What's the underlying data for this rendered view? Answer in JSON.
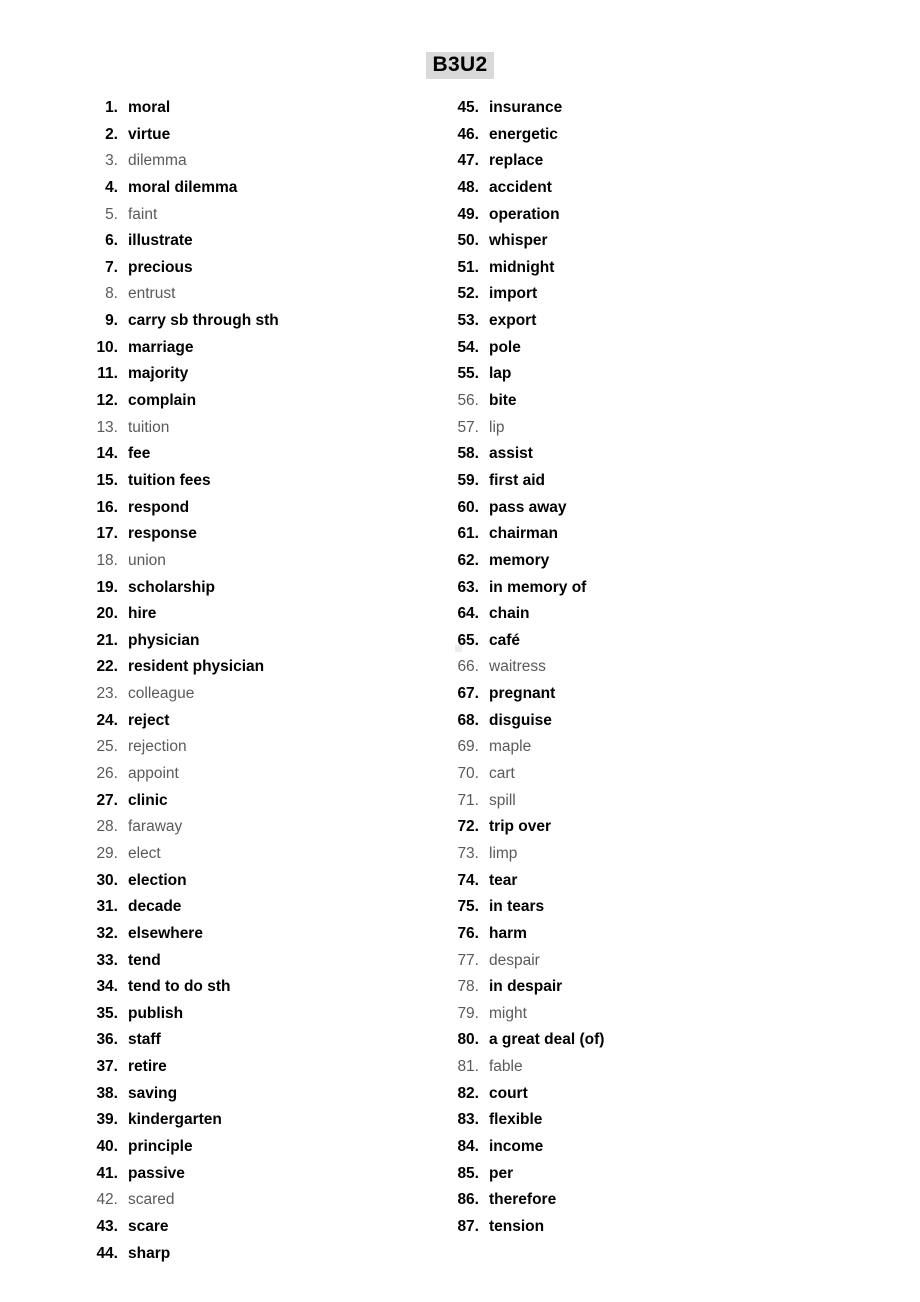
{
  "document": {
    "title": "B3U2",
    "title_highlight_color": "#d9d9d9",
    "bold_color": "#000000",
    "plain_color": "#5a5a5a"
  },
  "columns": {
    "left": {
      "items": [
        {
          "num": "1.",
          "word": "moral",
          "num_style": "bold",
          "word_style": "bold"
        },
        {
          "num": "2.",
          "word": "virtue",
          "num_style": "bold",
          "word_style": "bold"
        },
        {
          "num": "3.",
          "word": "dilemma",
          "num_style": "plain",
          "word_style": "plain"
        },
        {
          "num": "4.",
          "word": "moral dilemma",
          "num_style": "bold",
          "word_style": "bold"
        },
        {
          "num": "5.",
          "word": "faint",
          "num_style": "plain",
          "word_style": "plain"
        },
        {
          "num": "6.",
          "word": "illustrate",
          "num_style": "bold",
          "word_style": "bold"
        },
        {
          "num": "7.",
          "word": "precious",
          "num_style": "bold",
          "word_style": "bold"
        },
        {
          "num": "8.",
          "word": "entrust",
          "num_style": "plain",
          "word_style": "plain"
        },
        {
          "num": "9.",
          "word": "carry sb through sth",
          "num_style": "bold",
          "word_style": "bold"
        },
        {
          "num": "10.",
          "word": "marriage",
          "num_style": "bold",
          "word_style": "bold"
        },
        {
          "num": "11.",
          "word": "majority",
          "num_style": "bold",
          "word_style": "bold"
        },
        {
          "num": "12.",
          "word": "complain",
          "num_style": "bold",
          "word_style": "bold"
        },
        {
          "num": "13.",
          "word": "tuition",
          "num_style": "plain",
          "word_style": "plain"
        },
        {
          "num": "14.",
          "word": "fee",
          "num_style": "bold",
          "word_style": "bold"
        },
        {
          "num": "15.",
          "word": "tuition fees",
          "num_style": "bold",
          "word_style": "bold"
        },
        {
          "num": "16.",
          "word": "respond",
          "num_style": "bold",
          "word_style": "bold"
        },
        {
          "num": "17.",
          "word": "response",
          "num_style": "bold",
          "word_style": "bold"
        },
        {
          "num": "18.",
          "word": "union",
          "num_style": "plain",
          "word_style": "plain"
        },
        {
          "num": "19.",
          "word": "scholarship",
          "num_style": "bold",
          "word_style": "bold"
        },
        {
          "num": "20.",
          "word": "hire",
          "num_style": "bold",
          "word_style": "bold"
        },
        {
          "num": "21.",
          "word": "physician",
          "num_style": "bold",
          "word_style": "bold"
        },
        {
          "num": "22.",
          "word": "resident physician",
          "num_style": "bold",
          "word_style": "bold"
        },
        {
          "num": "23.",
          "word": "colleague",
          "num_style": "plain",
          "word_style": "plain"
        },
        {
          "num": "24.",
          "word": "reject",
          "num_style": "bold",
          "word_style": "bold"
        },
        {
          "num": "25.",
          "word": "rejection",
          "num_style": "plain",
          "word_style": "plain"
        },
        {
          "num": "26.",
          "word": "appoint",
          "num_style": "plain",
          "word_style": "plain"
        },
        {
          "num": "27.",
          "word": "clinic",
          "num_style": "bold",
          "word_style": "bold"
        },
        {
          "num": "28.",
          "word": "faraway",
          "num_style": "plain",
          "word_style": "plain"
        },
        {
          "num": "29.",
          "word": "elect",
          "num_style": "plain",
          "word_style": "plain"
        },
        {
          "num": "30.",
          "word": "election",
          "num_style": "bold",
          "word_style": "bold"
        },
        {
          "num": "31.",
          "word": "decade",
          "num_style": "bold",
          "word_style": "bold"
        },
        {
          "num": "32.",
          "word": "elsewhere",
          "num_style": "bold",
          "word_style": "bold"
        },
        {
          "num": "33.",
          "word": "tend",
          "num_style": "bold",
          "word_style": "bold"
        },
        {
          "num": "34.",
          "word": "tend to do sth",
          "num_style": "bold",
          "word_style": "bold"
        },
        {
          "num": "35.",
          "word": "publish",
          "num_style": "bold",
          "word_style": "bold"
        },
        {
          "num": "36.",
          "word": "staff",
          "num_style": "bold",
          "word_style": "bold"
        },
        {
          "num": "37.",
          "word": "retire",
          "num_style": "bold",
          "word_style": "bold"
        },
        {
          "num": "38.",
          "word": "saving",
          "num_style": "bold",
          "word_style": "bold"
        },
        {
          "num": "39.",
          "word": "kindergarten",
          "num_style": "bold",
          "word_style": "bold"
        },
        {
          "num": "40.",
          "word": "principle",
          "num_style": "bold",
          "word_style": "bold"
        },
        {
          "num": "41.",
          "word": "passive",
          "num_style": "bold",
          "word_style": "bold"
        },
        {
          "num": "42.",
          "word": "scared",
          "num_style": "plain",
          "word_style": "plain"
        },
        {
          "num": "43.",
          "word": "scare",
          "num_style": "bold",
          "word_style": "bold"
        },
        {
          "num": "44.",
          "word": "sharp",
          "num_style": "bold",
          "word_style": "bold"
        }
      ]
    },
    "right": {
      "items": [
        {
          "num": "45.",
          "word": "insurance",
          "num_style": "bold",
          "word_style": "bold"
        },
        {
          "num": "46.",
          "word": "energetic",
          "num_style": "bold",
          "word_style": "bold"
        },
        {
          "num": "47.",
          "word": "replace",
          "num_style": "bold",
          "word_style": "bold"
        },
        {
          "num": "48.",
          "word": "accident",
          "num_style": "bold",
          "word_style": "bold"
        },
        {
          "num": "49.",
          "word": "operation",
          "num_style": "bold",
          "word_style": "bold"
        },
        {
          "num": "50.",
          "word": "whisper",
          "num_style": "bold",
          "word_style": "bold"
        },
        {
          "num": "51.",
          "word": "midnight",
          "num_style": "bold",
          "word_style": "bold"
        },
        {
          "num": "52.",
          "word": "import",
          "num_style": "bold",
          "word_style": "bold"
        },
        {
          "num": "53.",
          "word": "export",
          "num_style": "bold",
          "word_style": "bold"
        },
        {
          "num": "54.",
          "word": "pole",
          "num_style": "bold",
          "word_style": "bold"
        },
        {
          "num": "55.",
          "word": "lap",
          "num_style": "bold",
          "word_style": "bold"
        },
        {
          "num": "56.",
          "word": "bite",
          "num_style": "plain",
          "word_style": "bold"
        },
        {
          "num": "57.",
          "word": "lip",
          "num_style": "plain",
          "word_style": "plain"
        },
        {
          "num": "58.",
          "word": "assist",
          "num_style": "bold",
          "word_style": "bold"
        },
        {
          "num": "59.",
          "word": "first aid",
          "num_style": "bold",
          "word_style": "bold"
        },
        {
          "num": "60.",
          "word": "pass away",
          "num_style": "bold",
          "word_style": "bold"
        },
        {
          "num": "61.",
          "word": "chairman",
          "num_style": "bold",
          "word_style": "bold"
        },
        {
          "num": "62.",
          "word": "memory",
          "num_style": "bold",
          "word_style": "bold"
        },
        {
          "num": "63.",
          "word": "in memory of",
          "num_style": "bold",
          "word_style": "bold"
        },
        {
          "num": "64.",
          "word": "chain",
          "num_style": "bold",
          "word_style": "bold"
        },
        {
          "num": "65.",
          "word": "café",
          "num_style": "bold",
          "word_style": "bold"
        },
        {
          "num": "66.",
          "word": "waitress",
          "num_style": "plain",
          "word_style": "plain"
        },
        {
          "num": "67.",
          "word": "pregnant",
          "num_style": "bold",
          "word_style": "bold"
        },
        {
          "num": "68.",
          "word": "disguise",
          "num_style": "bold",
          "word_style": "bold"
        },
        {
          "num": "69.",
          "word": "maple",
          "num_style": "plain",
          "word_style": "plain"
        },
        {
          "num": "70.",
          "word": "cart",
          "num_style": "plain",
          "word_style": "plain"
        },
        {
          "num": "71.",
          "word": "spill",
          "num_style": "plain",
          "word_style": "plain"
        },
        {
          "num": "72.",
          "word": "trip over",
          "num_style": "bold",
          "word_style": "bold"
        },
        {
          "num": "73.",
          "word": "limp",
          "num_style": "plain",
          "word_style": "plain"
        },
        {
          "num": "74.",
          "word": "tear",
          "num_style": "bold",
          "word_style": "bold"
        },
        {
          "num": "75.",
          "word": "in tears",
          "num_style": "bold",
          "word_style": "bold"
        },
        {
          "num": "76.",
          "word": "harm",
          "num_style": "bold",
          "word_style": "bold"
        },
        {
          "num": "77.",
          "word": "despair",
          "num_style": "plain",
          "word_style": "plain"
        },
        {
          "num": "78.",
          "word": "in despair",
          "num_style": "plain",
          "word_style": "bold"
        },
        {
          "num": "79.",
          "word": "might",
          "num_style": "plain",
          "word_style": "plain"
        },
        {
          "num": "80.",
          "word": "a great deal (of)",
          "num_style": "bold",
          "word_style": "bold"
        },
        {
          "num": "81.",
          "word": "fable",
          "num_style": "plain",
          "word_style": "plain"
        },
        {
          "num": "82.",
          "word": "court",
          "num_style": "bold",
          "word_style": "bold"
        },
        {
          "num": "83.",
          "word": "flexible",
          "num_style": "bold",
          "word_style": "bold"
        },
        {
          "num": "84.",
          "word": "income",
          "num_style": "bold",
          "word_style": "bold"
        },
        {
          "num": "85.",
          "word": "per",
          "num_style": "bold",
          "word_style": "bold"
        },
        {
          "num": "86.",
          "word": "therefore",
          "num_style": "bold",
          "word_style": "bold"
        },
        {
          "num": "87.",
          "word": "tension",
          "num_style": "bold",
          "word_style": "bold"
        }
      ]
    }
  }
}
